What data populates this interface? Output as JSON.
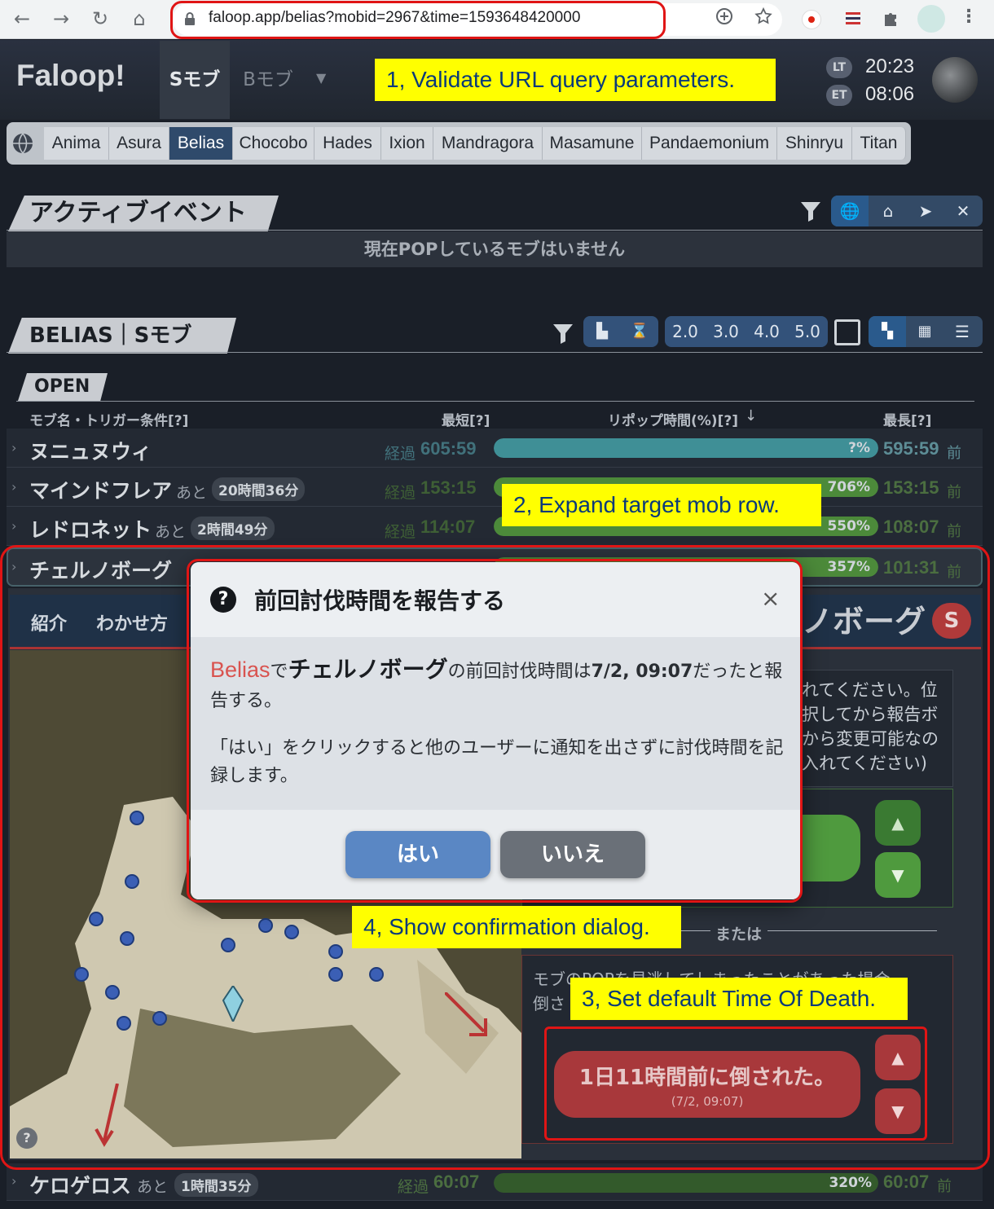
{
  "browser": {
    "url": "faloop.app/belias?mobid=2967&time=1593648420000",
    "back_glyph": "←",
    "forward_glyph": "→",
    "reload_glyph": "↻",
    "home_glyph": "⌂"
  },
  "header": {
    "logo": "Faloop!",
    "tabs": [
      "Sモブ",
      "Bモブ"
    ],
    "lt_label": "LT",
    "lt_time": "20:23",
    "et_label": "ET",
    "et_time": "08:06"
  },
  "worlds": {
    "items": [
      "Anima",
      "Asura",
      "Belias",
      "Chocobo",
      "Hades",
      "Ixion",
      "Mandragora",
      "Masamune",
      "Pandaemonium",
      "Shinryu",
      "Titan"
    ],
    "active": "Belias"
  },
  "active_events": {
    "title": "アクティブイベント",
    "empty_message": "現在POPしているモブはいません"
  },
  "mob_section": {
    "title": "BELIAS｜Sモブ",
    "patch_buttons": [
      "2.0",
      "3.0",
      "4.0",
      "5.0"
    ],
    "open_label": "OPEN",
    "columns": {
      "name": "モブ名・トリガー条件[?]",
      "min": "最短[?]",
      "repop": "リポップ時間(%)[?]",
      "max": "最長[?]"
    },
    "rows": [
      {
        "name": "ヌニュヌウィ",
        "remaining_prefix": "",
        "remaining": "",
        "elapsed_prefix": "経過",
        "elapsed": "605:59",
        "percent": "?%",
        "percent_value": 100,
        "max": "595:59",
        "max_suffix": "前"
      },
      {
        "name": "マインドフレア",
        "remaining_prefix": "あと",
        "remaining": "20時間36分",
        "elapsed_prefix": "経過",
        "elapsed": "153:15",
        "percent": "706%",
        "percent_value": 100,
        "max": "153:15",
        "max_suffix": "前"
      },
      {
        "name": "レドロネット",
        "remaining_prefix": "あと",
        "remaining": "2時間49分",
        "elapsed_prefix": "経過",
        "elapsed": "114:07",
        "percent": "550%",
        "percent_value": 100,
        "max": "108:07",
        "max_suffix": "前"
      },
      {
        "name": "チェルノボーグ",
        "remaining_prefix": "",
        "remaining": "",
        "elapsed_prefix": "",
        "elapsed": "",
        "percent": "357%",
        "percent_value": 100,
        "max": "101:31",
        "max_suffix": "前"
      }
    ],
    "last_row": {
      "name": "ケロゲロス",
      "remaining_prefix": "あと",
      "remaining": "1時間35分",
      "elapsed_prefix": "経過",
      "elapsed": "60:07",
      "percent": "320%",
      "max": "60:07",
      "max_suffix": "前"
    }
  },
  "detail": {
    "tabs": [
      "紹介",
      "わかせ方"
    ],
    "mob_title": "ノボーグ",
    "rank_badge": "S",
    "info_lines": [
      "れてください。位",
      "択してから報告ボ",
      "から変更可能なの",
      "入れてください)"
    ],
    "or_label": "または",
    "missed_text_1": "モブのPOPを見逃してしまったことがあった場合、",
    "missed_text_2": "倒さ",
    "defeated_button": "1日11時間前に倒された。",
    "defeated_sub": "(7/2, 09:07)"
  },
  "dialog": {
    "title": "前回討伐時間を報告する",
    "world": "Belias",
    "de": "で",
    "mob": "チェルノボーグ",
    "msg_1": "の前回討伐時間は",
    "time": "7/2, 09:07",
    "msg_2": "だったと報告する。",
    "note": "「はい」をクリックすると他のユーザーに通知を出さずに討伐時間を記録します。",
    "yes": "はい",
    "no": "いいえ"
  },
  "annotations": {
    "step1": "1, Validate URL query parameters.",
    "step2": "2, Expand target mob row.",
    "step3": "3, Set default Time Of Death.",
    "step4": "4, Show confirmation dialog."
  },
  "colors": {
    "accent_blue": "#33527a",
    "bar_teal": "#3f8f96",
    "bar_green": "#4c8a3a",
    "danger_red": "#a8383b",
    "annotation_yellow": "#ffff00",
    "annotation_border": "#e01515"
  }
}
